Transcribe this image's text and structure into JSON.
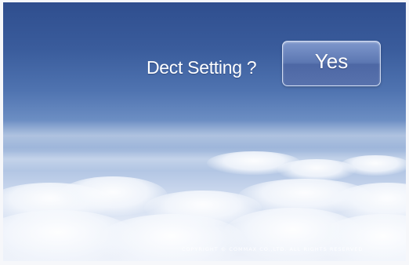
{
  "dialog": {
    "prompt": "Dect Setting ?",
    "confirm_label": "Yes"
  },
  "footer": {
    "copyright": "COPYRIGHT © COMMAX CO.,LTD. ALL RIGHTS RESERVED"
  },
  "colors": {
    "sky_top": "#2f4e8e",
    "sky_bottom": "#eef2fa",
    "button_fill": "#5c77b2",
    "text": "#ffffff"
  }
}
